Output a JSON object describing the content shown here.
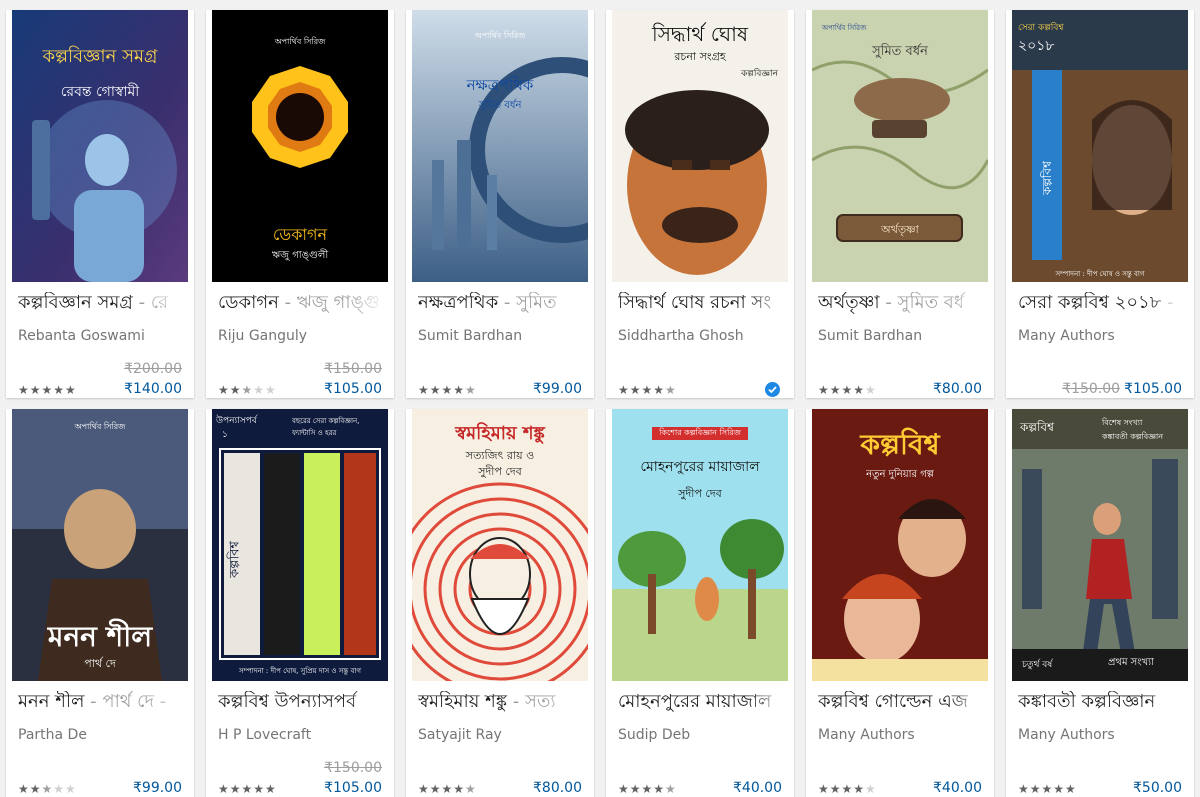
{
  "books": [
    {
      "title": "কল্পবিজ্ঞান সমগ্র",
      "title_sub": " - রে",
      "author": "Rebanta Goswami",
      "old_price": "₹200.00",
      "price": "₹140.00",
      "rating": 5,
      "cover_text": [
        "কল্পবিজ্ঞান সমগ্র",
        "রেবন্ত গোস্বামী"
      ]
    },
    {
      "title": "ডেকাগন",
      "title_sub": " - ঋজু গাঙ্গু",
      "author": "Riju Ganguly",
      "old_price": "₹150.00",
      "price": "₹105.00",
      "rating": 2.5,
      "cover_text": [
        "অপার্থিব সিরিজ",
        "ডেকাগন",
        "ঋজু গাঙ্গুলী"
      ]
    },
    {
      "title": "নক্ষত্রপথিক",
      "title_sub": " - সুমিত",
      "author": "Sumit Bardhan",
      "old_price": "",
      "price": "₹99.00",
      "rating": 4.5,
      "cover_text": [
        "অপার্থিব সিরিজ",
        "নক্ষত্রপথিক",
        "সুমিত বর্ধন"
      ]
    },
    {
      "title": "সিদ্ধার্থ ঘোষ রচনা সং",
      "title_sub": "",
      "author": "Siddhartha Ghosh",
      "old_price": "",
      "price": "",
      "rating": 4.5,
      "verified": true,
      "cover_text": [
        "সিদ্ধার্থ ঘোষ",
        "রচনা সংগ্রহ",
        "কল্পবিজ্ঞান"
      ]
    },
    {
      "title": "অর্থতৃষ্ণা",
      "title_sub": " - সুমিত বর্ধ",
      "author": "Sumit Bardhan",
      "old_price": "",
      "price": "₹80.00",
      "rating": 4,
      "cover_text": [
        "অপার্থিব সিরিজ",
        "সুমিত বর্ধন",
        "অর্থতৃষ্ণা"
      ]
    },
    {
      "title": "সেরা কল্পবিশ্ব ২০১৮",
      "title_sub": " - ",
      "author": "Many Authors",
      "old_price": "",
      "price_strike": "₹150.00",
      "price": "₹105.00",
      "rating": 0,
      "cover_text": [
        "সেরা কল্পবিশ্ব",
        "২০১৮",
        "কল্পবিশ্ব",
        "সম্পাদনা : দীপ ঘোষ ও সন্তু বাগ"
      ]
    },
    {
      "title": "মনন শীল",
      "title_sub": " - পার্থ দে - ",
      "author": "Partha De",
      "old_price": "",
      "price": "₹99.00",
      "rating": 2.5,
      "cover_text": [
        "অপার্থিব সিরিজ",
        "মনন শীল",
        "পার্থ দে"
      ]
    },
    {
      "title": "কল্পবিশ্ব উপন্যাসপর্ব",
      "title_sub": "",
      "author": "H P Lovecraft",
      "old_price": "₹150.00",
      "price": "₹105.00",
      "rating": 5,
      "cover_text": [
        "উপন্যাসপর্ব",
        "১",
        "বছরের সেরা কল্পবিজ্ঞান, ফ্যান্টাসি ও হরর",
        "কল্পবিশ্ব",
        "সম্পাদনা : দীপ ঘোষ, সুপ্রিয় দাস ও সন্তু বাগ"
      ]
    },
    {
      "title": "স্বমহিমায় শঙ্কু",
      "title_sub": " - সত্য",
      "author": "Satyajit Ray",
      "old_price": "",
      "price": "₹80.00",
      "rating": 4.5,
      "cover_text": [
        "স্বমহিমায় শঙ্কু",
        "সত্যজিৎ রায় ও",
        "সুদীপ দেব"
      ]
    },
    {
      "title": "মোহনপুরের মায়াজাল",
      "title_sub": "",
      "author": "Sudip Deb",
      "old_price": "",
      "price": "₹40.00",
      "rating": 4.5,
      "cover_text": [
        "কিশোর কল্পবিজ্ঞান সিরিজ",
        "মোহনপুরের মায়াজাল",
        "সুদীপ দেব"
      ]
    },
    {
      "title": "কল্পবিশ্ব গোল্ডেন এজ",
      "title_sub": "",
      "author": "Many Authors",
      "old_price": "",
      "price": "₹40.00",
      "rating": 4,
      "cover_text": [
        "কল্পবিশ্ব",
        "নতুন দুনিয়ার গল্প"
      ]
    },
    {
      "title": "কঙ্কাবতী কল্পবিজ্ঞান",
      "title_sub": "",
      "author": "Many Authors",
      "old_price": "",
      "price": "₹50.00",
      "rating": 5,
      "cover_text": [
        "কল্পবিশ্ব",
        "বিশেষ সংখ্যা",
        "কঙ্কাবতী কল্পবিজ্ঞান",
        "চতুর্থ বর্ষ",
        "প্রথম সংখ্যা"
      ]
    }
  ],
  "colors": {
    "price": "#01579b",
    "verified": "#1e88e5",
    "stars": "#616161"
  }
}
